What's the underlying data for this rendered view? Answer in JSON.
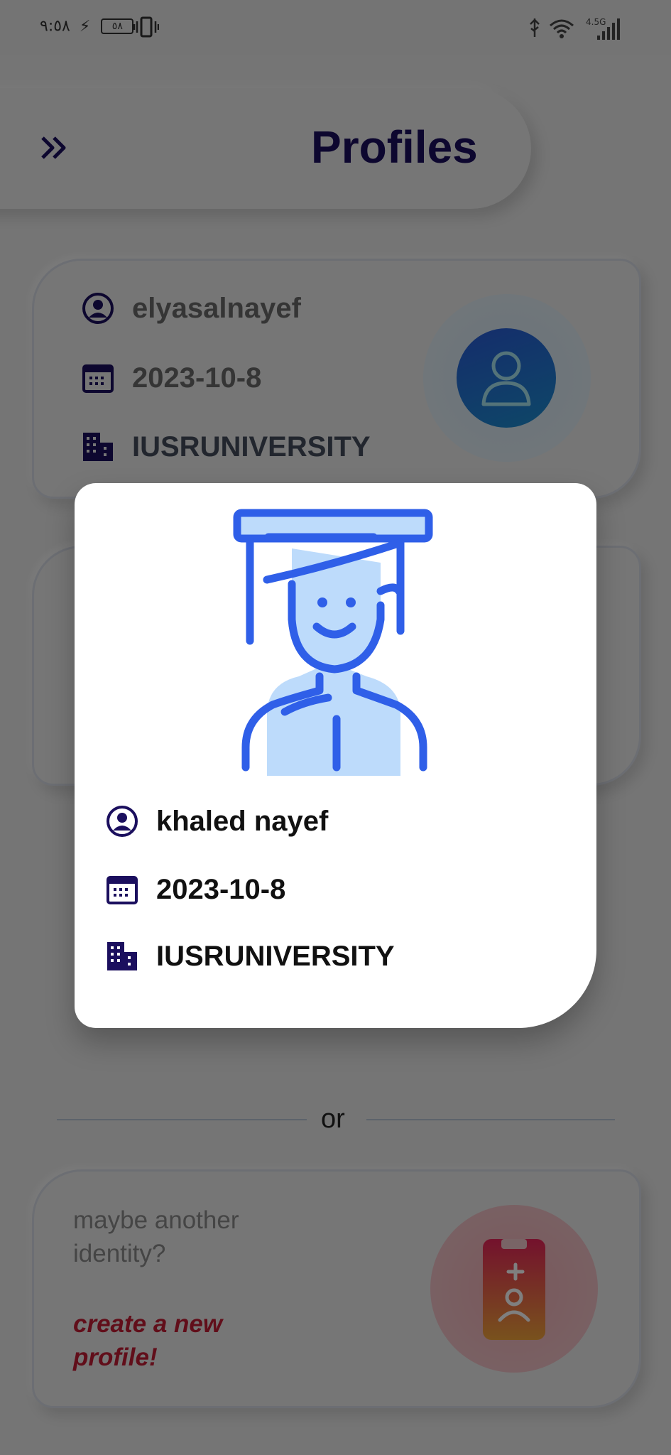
{
  "status_bar": {
    "time": "٩:٥٨",
    "battery": "٥٨",
    "network": "4.5G"
  },
  "header": {
    "title": "Profiles",
    "menu_icon": "double-chevron-right-icon"
  },
  "profile_card": {
    "username": "elyasalnayef",
    "date": "2023-10-8",
    "organization": "IUSRUNIVERSITY",
    "avatar_icon": "user-avatar-icon"
  },
  "divider": {
    "text": "or"
  },
  "new_profile": {
    "prompt": "maybe another identity?",
    "action": "create a new profile!",
    "icon": "add-profile-badge-icon"
  },
  "dialog": {
    "illustration": "graduate-student-icon",
    "name": "khaled nayef",
    "date": "2023-10-8",
    "organization": "IUSRUNIVERSITY"
  },
  "colors": {
    "title": "#1b0f5e",
    "icon": "#1b0f5e",
    "accent_red": "#c21c35",
    "illustration_blue": "#2f5fe8"
  }
}
